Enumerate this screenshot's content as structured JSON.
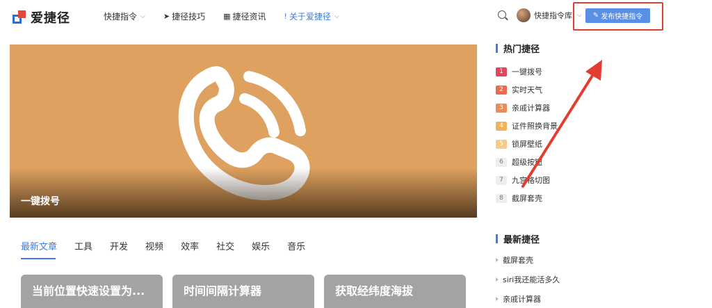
{
  "header": {
    "logo_text": "爱捷径",
    "nav": [
      {
        "icon": "apple-icon",
        "glyph": "",
        "label": "快捷指令",
        "dropdown": true,
        "active": false
      },
      {
        "icon": "rocket-icon",
        "glyph": "➤",
        "label": "捷径技巧",
        "dropdown": false,
        "active": false
      },
      {
        "icon": "grid-icon",
        "glyph": "▦",
        "label": "捷径资讯",
        "dropdown": false,
        "active": false
      },
      {
        "icon": "exclamation-icon",
        "glyph": "!",
        "label": "关于爱捷径",
        "dropdown": true,
        "active": true
      }
    ],
    "user_name": "快捷指令库",
    "publish_label": "发布快捷指令"
  },
  "hero": {
    "title": "一键拨号",
    "bg_color": "#dea15f"
  },
  "tabs": [
    "最新文章",
    "工具",
    "开发",
    "视频",
    "效率",
    "社交",
    "娱乐",
    "音乐"
  ],
  "cards": [
    "当前位置快速设置为...",
    "时间间隔计算器",
    "获取经纬度海拔"
  ],
  "sidebar": {
    "hot_title": "热门捷径",
    "hot_items": [
      {
        "rank": "1",
        "label": "一键拨号",
        "color": "#e0475a"
      },
      {
        "rank": "2",
        "label": "实时天气",
        "color": "#ec6a4d"
      },
      {
        "rank": "3",
        "label": "亲戚计算器",
        "color": "#ee8c50"
      },
      {
        "rank": "4",
        "label": "证件照换背景",
        "color": "#f2b25c"
      },
      {
        "rank": "5",
        "label": "锁屏壁纸",
        "color": "#f5cb86"
      },
      {
        "rank": "6",
        "label": "超级按钮",
        "color": ""
      },
      {
        "rank": "7",
        "label": "九宫格切图",
        "color": ""
      },
      {
        "rank": "8",
        "label": "截屏套壳",
        "color": ""
      }
    ],
    "new_title": "最新捷径",
    "new_items": [
      "截屏套壳",
      "siri我还能活多久",
      "亲戚计算器"
    ]
  },
  "colors": {
    "accent": "#3f7de0",
    "annotation": "#e43d2f"
  }
}
